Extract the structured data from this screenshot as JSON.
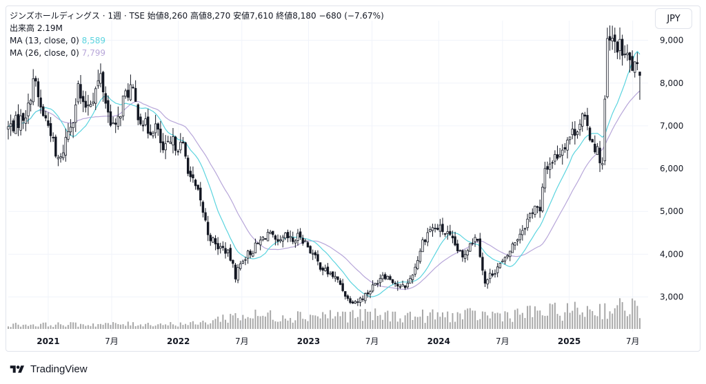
{
  "legend": {
    "title_line": "ジンズホールディングス · 1週 · TSE  始値8,260  高値8,270  安値7,610  終値8,180  −680 (−7.67%)",
    "volume_line": "出来高  2.19M",
    "ma13_label": "MA (13, close, 0)",
    "ma13_value": "8,589",
    "ma26_label": "MA (26, close, 0)",
    "ma26_value": "7,799"
  },
  "currency_button": "JPY",
  "brand": {
    "name": "TradingView"
  },
  "colors": {
    "candle": "#131722",
    "volume": "#a8a8a8",
    "ma13": "#5ad4df",
    "ma26": "#b7a6d9",
    "grid": "#f0f3fa"
  },
  "chart_data": {
    "type": "candlestick",
    "interval": "1 week",
    "ylim": [
      2300,
      9300
    ],
    "y_ticks": [
      {
        "value": 3000,
        "label": "3,000"
      },
      {
        "value": 4000,
        "label": "4,000"
      },
      {
        "value": 5000,
        "label": "5,000"
      },
      {
        "value": 6000,
        "label": "6,000"
      },
      {
        "value": 7000,
        "label": "7,000"
      },
      {
        "value": 8000,
        "label": "8,000"
      },
      {
        "value": 9000,
        "label": "9,000"
      }
    ],
    "x_ticks": [
      {
        "date": "2021-01-04",
        "label": "2021",
        "bold": true
      },
      {
        "date": "2021-07-01",
        "label": "7月",
        "bold": false
      },
      {
        "date": "2022-01-04",
        "label": "2022",
        "bold": true
      },
      {
        "date": "2022-07-01",
        "label": "7月",
        "bold": false
      },
      {
        "date": "2023-01-04",
        "label": "2023",
        "bold": true
      },
      {
        "date": "2023-07-01",
        "label": "7月",
        "bold": false
      },
      {
        "date": "2024-01-04",
        "label": "2024",
        "bold": true
      },
      {
        "date": "2024-07-01",
        "label": "7月",
        "bold": false
      },
      {
        "date": "2025-01-04",
        "label": "2025",
        "bold": true
      },
      {
        "date": "2025-07-01",
        "label": "7月",
        "bold": false
      }
    ],
    "x_range": [
      "2020-09-14",
      "2025-07-21"
    ],
    "close_anchors": [
      [
        "2020-09-14",
        6950
      ],
      [
        "2020-10-19",
        7150
      ],
      [
        "2020-11-09",
        7400
      ],
      [
        "2020-11-23",
        8150
      ],
      [
        "2020-12-14",
        7400
      ],
      [
        "2021-01-11",
        6900
      ],
      [
        "2021-01-25",
        6250
      ],
      [
        "2021-02-08",
        6200
      ],
      [
        "2021-02-22",
        6700
      ],
      [
        "2021-03-15",
        7250
      ],
      [
        "2021-03-29",
        7900
      ],
      [
        "2021-04-12",
        7400
      ],
      [
        "2021-05-10",
        7700
      ],
      [
        "2021-05-31",
        8150
      ],
      [
        "2021-06-21",
        7300
      ],
      [
        "2021-07-12",
        6900
      ],
      [
        "2021-08-02",
        7600
      ],
      [
        "2021-08-23",
        7900
      ],
      [
        "2021-09-13",
        7300
      ],
      [
        "2021-10-11",
        6900
      ],
      [
        "2021-11-01",
        7000
      ],
      [
        "2021-11-22",
        6400
      ],
      [
        "2021-12-20",
        6600
      ],
      [
        "2022-01-17",
        6500
      ],
      [
        "2022-02-07",
        5800
      ],
      [
        "2022-02-28",
        5400
      ],
      [
        "2022-03-14",
        5000
      ],
      [
        "2022-03-28",
        4500
      ],
      [
        "2022-04-18",
        4200
      ],
      [
        "2022-05-16",
        4100
      ],
      [
        "2022-05-30",
        3900
      ],
      [
        "2022-06-13",
        3500
      ],
      [
        "2022-07-04",
        3900
      ],
      [
        "2022-08-01",
        4100
      ],
      [
        "2022-08-22",
        4300
      ],
      [
        "2022-09-12",
        4500
      ],
      [
        "2022-10-10",
        4200
      ],
      [
        "2022-10-31",
        4400
      ],
      [
        "2022-11-21",
        4300
      ],
      [
        "2022-12-12",
        4450
      ],
      [
        "2023-01-09",
        4100
      ],
      [
        "2023-01-30",
        3800
      ],
      [
        "2023-02-20",
        3600
      ],
      [
        "2023-03-13",
        3500
      ],
      [
        "2023-04-03",
        3300
      ],
      [
        "2023-04-24",
        2950
      ],
      [
        "2023-05-22",
        2900
      ],
      [
        "2023-06-19",
        3100
      ],
      [
        "2023-07-10",
        3300
      ],
      [
        "2023-07-31",
        3550
      ],
      [
        "2023-08-28",
        3400
      ],
      [
        "2023-09-18",
        3200
      ],
      [
        "2023-10-09",
        3300
      ],
      [
        "2023-10-30",
        3700
      ],
      [
        "2023-11-20",
        4300
      ],
      [
        "2023-12-11",
        4600
      ],
      [
        "2024-01-08",
        4600
      ],
      [
        "2024-01-29",
        4450
      ],
      [
        "2024-02-19",
        4200
      ],
      [
        "2024-03-11",
        3900
      ],
      [
        "2024-04-01",
        4300
      ],
      [
        "2024-04-22",
        4400
      ],
      [
        "2024-05-13",
        3300
      ],
      [
        "2024-05-27",
        3500
      ],
      [
        "2024-06-17",
        3700
      ],
      [
        "2024-07-08",
        3850
      ],
      [
        "2024-07-29",
        4200
      ],
      [
        "2024-08-19",
        4500
      ],
      [
        "2024-09-09",
        4800
      ],
      [
        "2024-09-30",
        5150
      ],
      [
        "2024-10-14",
        4950
      ],
      [
        "2024-10-28",
        6000
      ],
      [
        "2024-11-18",
        6200
      ],
      [
        "2024-12-09",
        6400
      ],
      [
        "2024-12-30",
        6700
      ],
      [
        "2025-01-20",
        6900
      ],
      [
        "2025-02-10",
        7200
      ],
      [
        "2025-03-03",
        6800
      ],
      [
        "2025-03-24",
        6400
      ],
      [
        "2025-04-07",
        6100
      ],
      [
        "2025-04-21",
        8950
      ],
      [
        "2025-05-19",
        8900
      ],
      [
        "2025-06-09",
        8650
      ],
      [
        "2025-06-30",
        8400
      ],
      [
        "2025-07-21",
        8180
      ]
    ],
    "volume_profile": [
      [
        "2020-09-14",
        0.18
      ],
      [
        "2022-03-01",
        0.22
      ],
      [
        "2022-06-01",
        0.55
      ],
      [
        "2023-04-01",
        0.6
      ],
      [
        "2023-11-01",
        0.55
      ],
      [
        "2024-06-01",
        0.6
      ],
      [
        "2025-04-15",
        0.85
      ],
      [
        "2025-07-21",
        0.95
      ]
    ],
    "last": {
      "open": 8260,
      "high": 8270,
      "low": 7610,
      "close": 8180,
      "change": -680,
      "change_pct": -7.67,
      "volume": "2.19M"
    },
    "series": [
      {
        "name": "MA (13, close, 0)",
        "last_value": 8589
      },
      {
        "name": "MA (26, close, 0)",
        "last_value": 7799
      }
    ]
  }
}
